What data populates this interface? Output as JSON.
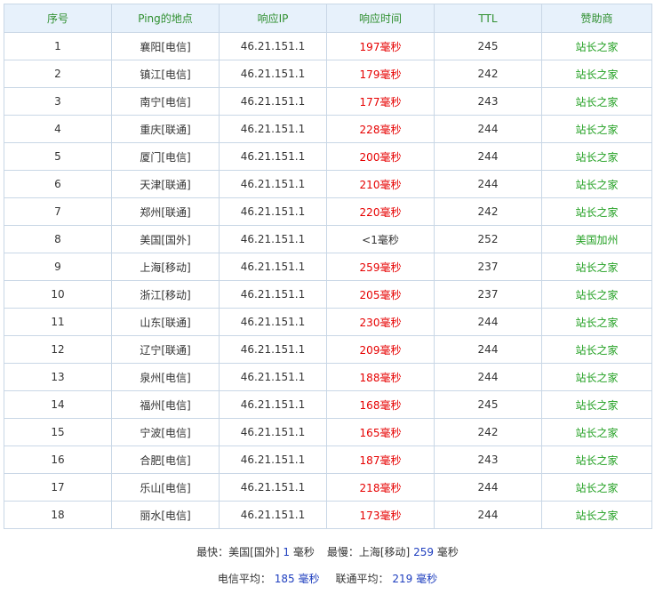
{
  "table": {
    "headers": [
      "序号",
      "Ping的地点",
      "响应IP",
      "响应时间",
      "TTL",
      "赞助商"
    ],
    "rows": [
      {
        "no": "1",
        "location": "襄阳[电信]",
        "ip": "46.21.151.1",
        "time": "197毫秒",
        "ttl": "245",
        "sponsor": "站长之家",
        "time_red": true
      },
      {
        "no": "2",
        "location": "镇江[电信]",
        "ip": "46.21.151.1",
        "time": "179毫秒",
        "ttl": "242",
        "sponsor": "站长之家",
        "time_red": true
      },
      {
        "no": "3",
        "location": "南宁[电信]",
        "ip": "46.21.151.1",
        "time": "177毫秒",
        "ttl": "243",
        "sponsor": "站长之家",
        "time_red": true
      },
      {
        "no": "4",
        "location": "重庆[联通]",
        "ip": "46.21.151.1",
        "time": "228毫秒",
        "ttl": "244",
        "sponsor": "站长之家",
        "time_red": true
      },
      {
        "no": "5",
        "location": "厦门[电信]",
        "ip": "46.21.151.1",
        "time": "200毫秒",
        "ttl": "244",
        "sponsor": "站长之家",
        "time_red": true
      },
      {
        "no": "6",
        "location": "天津[联通]",
        "ip": "46.21.151.1",
        "time": "210毫秒",
        "ttl": "244",
        "sponsor": "站长之家",
        "time_red": true
      },
      {
        "no": "7",
        "location": "郑州[联通]",
        "ip": "46.21.151.1",
        "time": "220毫秒",
        "ttl": "242",
        "sponsor": "站长之家",
        "time_red": true
      },
      {
        "no": "8",
        "location": "美国[国外]",
        "ip": "46.21.151.1",
        "time": "<1毫秒",
        "ttl": "252",
        "sponsor": "美国加州",
        "time_red": false
      },
      {
        "no": "9",
        "location": "上海[移动]",
        "ip": "46.21.151.1",
        "time": "259毫秒",
        "ttl": "237",
        "sponsor": "站长之家",
        "time_red": true
      },
      {
        "no": "10",
        "location": "浙江[移动]",
        "ip": "46.21.151.1",
        "time": "205毫秒",
        "ttl": "237",
        "sponsor": "站长之家",
        "time_red": true
      },
      {
        "no": "11",
        "location": "山东[联通]",
        "ip": "46.21.151.1",
        "time": "230毫秒",
        "ttl": "244",
        "sponsor": "站长之家",
        "time_red": true
      },
      {
        "no": "12",
        "location": "辽宁[联通]",
        "ip": "46.21.151.1",
        "time": "209毫秒",
        "ttl": "244",
        "sponsor": "站长之家",
        "time_red": true
      },
      {
        "no": "13",
        "location": "泉州[电信]",
        "ip": "46.21.151.1",
        "time": "188毫秒",
        "ttl": "244",
        "sponsor": "站长之家",
        "time_red": true
      },
      {
        "no": "14",
        "location": "福州[电信]",
        "ip": "46.21.151.1",
        "time": "168毫秒",
        "ttl": "245",
        "sponsor": "站长之家",
        "time_red": true
      },
      {
        "no": "15",
        "location": "宁波[电信]",
        "ip": "46.21.151.1",
        "time": "165毫秒",
        "ttl": "242",
        "sponsor": "站长之家",
        "time_red": true
      },
      {
        "no": "16",
        "location": "合肥[电信]",
        "ip": "46.21.151.1",
        "time": "187毫秒",
        "ttl": "243",
        "sponsor": "站长之家",
        "time_red": true
      },
      {
        "no": "17",
        "location": "乐山[电信]",
        "ip": "46.21.151.1",
        "time": "218毫秒",
        "ttl": "244",
        "sponsor": "站长之家",
        "time_red": true
      },
      {
        "no": "18",
        "location": "丽水[电信]",
        "ip": "46.21.151.1",
        "time": "173毫秒",
        "ttl": "244",
        "sponsor": "站长之家",
        "time_red": true
      }
    ]
  },
  "summary": {
    "fastest_label": "最快：",
    "fastest_location": "美国[国外]",
    "fastest_value": "1",
    "fastest_unit": "毫秒",
    "slowest_label": "最慢：",
    "slowest_location": "上海[移动]",
    "slowest_value": "259",
    "slowest_unit": "毫秒",
    "telecom_label": "电信平均：",
    "telecom_value": "185 毫秒",
    "unicom_label": "联通平均：",
    "unicom_value": "219 毫秒"
  },
  "colors": {
    "header_bg": "#e7f1fb",
    "header_text": "#2f8f2f",
    "border": "#c9d7e6",
    "delay_red": "#e60000",
    "sponsor_green": "#22a022",
    "summary_number": "#1f3fbf"
  }
}
